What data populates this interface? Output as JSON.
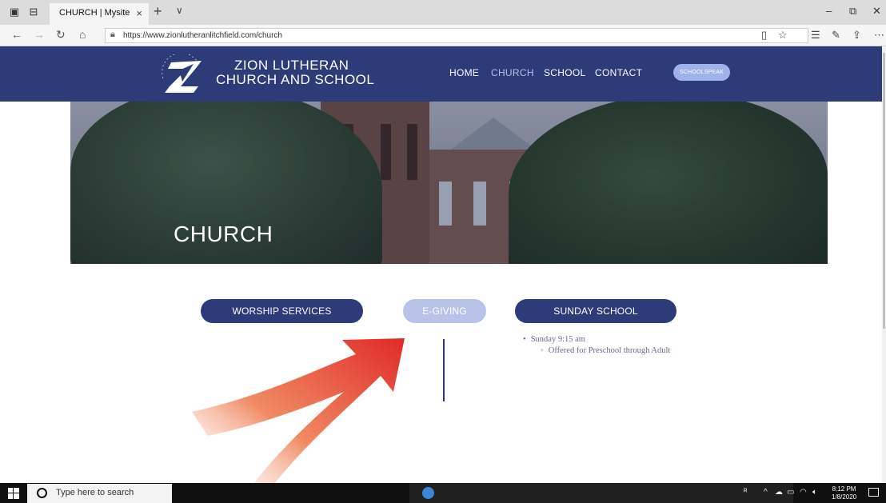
{
  "browser": {
    "tab_title": "CHURCH | Mysite",
    "tab_close": "×",
    "new_tab": "+",
    "tab_menu": "∨",
    "url": "https://www.zionlutheranlitchfield.com/church",
    "window_controls": {
      "minimize": "–",
      "restore": "⧉",
      "close": "✕"
    },
    "icons": [
      "set-aside-tabs-icon",
      "show-tabs-icon",
      "back-icon",
      "forward-icon",
      "refresh-icon",
      "home-icon",
      "lock-icon",
      "reading-view-icon",
      "favorite-star-icon",
      "favorites-list-icon",
      "notes-icon",
      "share-icon",
      "more-icon"
    ]
  },
  "site": {
    "brand_line1": "ZION LUTHERAN",
    "brand_line2": "CHURCH AND SCHOOL",
    "logo_text": "ZION LUTHERAN",
    "nav": [
      {
        "label": "HOME"
      },
      {
        "label": "CHURCH"
      },
      {
        "label": "SCHOOL"
      },
      {
        "label": "CONTACT"
      }
    ],
    "schoolspeak_label": "SCHOOLSPEAK",
    "colors": {
      "header": "#2d3b78",
      "accent_light": "#b9c3ea",
      "arrow": "#e8302a"
    }
  },
  "hero": {
    "title": "CHURCH"
  },
  "content": {
    "buttons": {
      "worship": "WORSHIP SERVICES",
      "egiving": "E-GIVING",
      "sunday": "SUNDAY SCHOOL"
    },
    "sunday_list": {
      "item": "Sunday 9:15 am",
      "subitem": "Offered for Preschool through Adult"
    }
  },
  "taskbar": {
    "search_placeholder": "Type here to search",
    "time": "8:12 PM",
    "date": "1/8/2020"
  }
}
